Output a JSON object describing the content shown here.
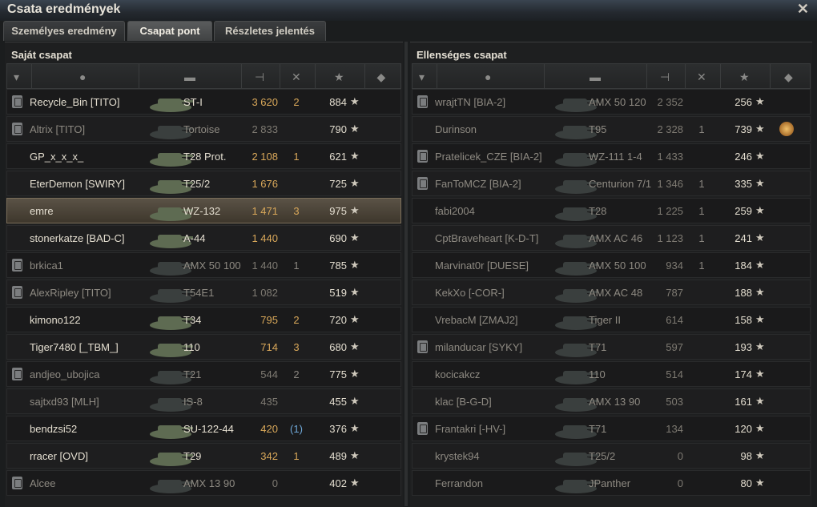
{
  "window": {
    "title": "Csata eredmények",
    "close_glyph": "✕"
  },
  "tabs": [
    {
      "label": "Személyes eredmény",
      "active": false
    },
    {
      "label": "Csapat pont",
      "active": true
    },
    {
      "label": "Részletes jelentés",
      "active": false
    }
  ],
  "teams": {
    "left": {
      "title": "Saját csapat",
      "rows": [
        {
          "name": "Recycle_Bin [TITO]",
          "tank": "ST-I",
          "damage": "3 620",
          "kills": "2",
          "xp": "884",
          "dead": false,
          "badge": true
        },
        {
          "name": "Altrix [TITO]",
          "tank": "Tortoise",
          "damage": "2 833",
          "kills": "",
          "xp": "790",
          "dead": true,
          "badge": true
        },
        {
          "name": "GP_x_x_x_",
          "tank": "T28 Prot.",
          "damage": "2 108",
          "kills": "1",
          "xp": "621",
          "dead": false,
          "badge": false
        },
        {
          "name": "EterDemon [SWIRY]",
          "tank": "T25/2",
          "damage": "1 676",
          "kills": "",
          "xp": "725",
          "dead": false,
          "badge": false
        },
        {
          "name": "emre",
          "tank": "WZ-132",
          "damage": "1 471",
          "kills": "3",
          "xp": "975",
          "dead": false,
          "badge": false,
          "me": true
        },
        {
          "name": "stonerkatze [BAD-C]",
          "tank": "A-44",
          "damage": "1 440",
          "kills": "",
          "xp": "690",
          "dead": false,
          "badge": false
        },
        {
          "name": "brkica1",
          "tank": "AMX 50 100",
          "damage": "1 440",
          "kills": "1",
          "xp": "785",
          "dead": true,
          "badge": true
        },
        {
          "name": "AlexRipley [TITO]",
          "tank": "T54E1",
          "damage": "1 082",
          "kills": "",
          "xp": "519",
          "dead": true,
          "badge": true
        },
        {
          "name": "kimono122",
          "tank": "T34",
          "damage": "795",
          "kills": "2",
          "xp": "720",
          "dead": false,
          "badge": false
        },
        {
          "name": "Tiger7480 [_TBM_]",
          "tank": "110",
          "damage": "714",
          "kills": "3",
          "xp": "680",
          "dead": false,
          "badge": false
        },
        {
          "name": "andjeo_ubojica",
          "tank": "T21",
          "damage": "544",
          "kills": "2",
          "xp": "775",
          "dead": true,
          "badge": true
        },
        {
          "name": "sajtxd93 [MLH]",
          "tank": "IS-8",
          "damage": "435",
          "kills": "",
          "xp": "455",
          "dead": true,
          "badge": false
        },
        {
          "name": "bendzsi52",
          "tank": "SU-122-44",
          "damage": "420",
          "kills": "(1)",
          "xp": "376",
          "dead": false,
          "badge": false
        },
        {
          "name": "rracer [OVD]",
          "tank": "T29",
          "damage": "342",
          "kills": "1",
          "xp": "489",
          "dead": false,
          "badge": false
        },
        {
          "name": "Alcee",
          "tank": "AMX 13 90",
          "damage": "0",
          "kills": "",
          "xp": "402",
          "dead": true,
          "badge": true
        }
      ]
    },
    "right": {
      "title": "Ellenséges csapat",
      "rows": [
        {
          "name": "wrajtTN [BIA-2]",
          "tank": "AMX 50 120",
          "damage": "2 352",
          "kills": "",
          "xp": "256",
          "dead": true,
          "badge": true
        },
        {
          "name": "Durinson",
          "tank": "T95",
          "damage": "2 328",
          "kills": "1",
          "xp": "739",
          "dead": true,
          "badge": false,
          "medal": true
        },
        {
          "name": "Pratelicek_CZE [BIA-2]",
          "tank": "WZ-111 1-4",
          "damage": "1 433",
          "kills": "",
          "xp": "246",
          "dead": true,
          "badge": true
        },
        {
          "name": "FanToMCZ [BIA-2]",
          "tank": "Centurion 7/1",
          "damage": "1 346",
          "kills": "1",
          "xp": "335",
          "dead": true,
          "badge": true
        },
        {
          "name": "fabi2004",
          "tank": "T28",
          "damage": "1 225",
          "kills": "1",
          "xp": "259",
          "dead": true,
          "badge": false
        },
        {
          "name": "CptBraveheart [K-D-T]",
          "tank": "AMX AC 46",
          "damage": "1 123",
          "kills": "1",
          "xp": "241",
          "dead": true,
          "badge": false
        },
        {
          "name": "Marvinat0r [DUESE]",
          "tank": "AMX 50 100",
          "damage": "934",
          "kills": "1",
          "xp": "184",
          "dead": true,
          "badge": false
        },
        {
          "name": "KekXo [-COR-]",
          "tank": "AMX AC 48",
          "damage": "787",
          "kills": "",
          "xp": "188",
          "dead": true,
          "badge": false
        },
        {
          "name": "VrebacM [ZMAJ2]",
          "tank": "Tiger II",
          "damage": "614",
          "kills": "",
          "xp": "158",
          "dead": true,
          "badge": false
        },
        {
          "name": "milanducar [SYKY]",
          "tank": "T71",
          "damage": "597",
          "kills": "",
          "xp": "193",
          "dead": true,
          "badge": true
        },
        {
          "name": "kocicakcz",
          "tank": "110",
          "damage": "514",
          "kills": "",
          "xp": "174",
          "dead": true,
          "badge": false
        },
        {
          "name": "klac [B-G-D]",
          "tank": "AMX 13 90",
          "damage": "503",
          "kills": "",
          "xp": "161",
          "dead": true,
          "badge": false
        },
        {
          "name": "Frantakri [-HV-]",
          "tank": "T71",
          "damage": "134",
          "kills": "",
          "xp": "120",
          "dead": true,
          "badge": true
        },
        {
          "name": "krystek94",
          "tank": "T25/2",
          "damage": "0",
          "kills": "",
          "xp": "98",
          "dead": true,
          "badge": false
        },
        {
          "name": "Ferrandon",
          "tank": "JPanther",
          "damage": "0",
          "kills": "",
          "xp": "80",
          "dead": true,
          "badge": false
        }
      ]
    }
  },
  "icons": {
    "star": "★",
    "badge": "badge-icon",
    "player": "player-icon",
    "tank": "tank-icon",
    "damage": "damage-icon",
    "kills": "kills-icon",
    "xp": "xp-star-icon",
    "medals": "medal-icon"
  },
  "colors": {
    "damage": "#d9a85a",
    "text": "#e4ded0",
    "dead": "#8e8a82",
    "highlight": "#5a5246"
  }
}
